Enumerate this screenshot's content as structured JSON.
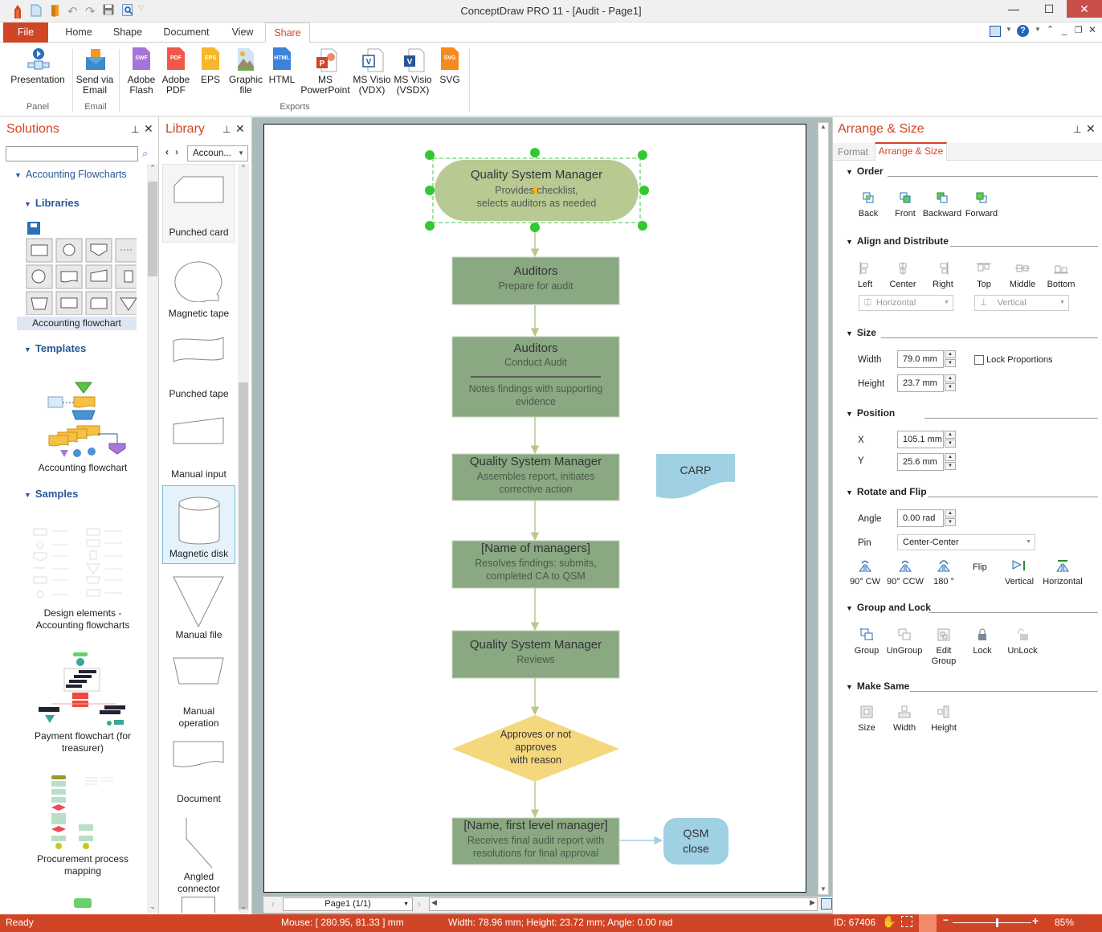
{
  "window": {
    "title": "ConceptDraw PRO 11 - [Audit - Page1]",
    "minimize": "—",
    "maximize": "☐",
    "close": "✕"
  },
  "ribbon_tabs": [
    {
      "label": "File"
    },
    {
      "label": "Home"
    },
    {
      "label": "Shape"
    },
    {
      "label": "Document"
    },
    {
      "label": "View"
    },
    {
      "label": "Share",
      "active": true
    }
  ],
  "ribbon": {
    "groups": [
      {
        "label": "Panel"
      },
      {
        "label": "Email"
      },
      {
        "label": "Exports"
      }
    ],
    "buttons": [
      {
        "label": "Presentation",
        "icon": "presentation-icon"
      },
      {
        "label": "Send via\nEmail",
        "icon": "email-icon"
      },
      {
        "label": "Adobe\nFlash",
        "icon": "swf-file-icon",
        "badge": "SWF",
        "color": "#a674d6"
      },
      {
        "label": "Adobe\nPDF",
        "icon": "pdf-file-icon",
        "badge": "PDF",
        "color": "#f0584a"
      },
      {
        "label": "EPS",
        "icon": "eps-file-icon",
        "badge": "EPS",
        "color": "#f8b62a"
      },
      {
        "label": "Graphic\nfile",
        "icon": "image-file-icon"
      },
      {
        "label": "HTML",
        "icon": "html-file-icon",
        "badge": "HTML",
        "color": "#3c82d8"
      },
      {
        "label": "MS\nPowerPoint",
        "icon": "powerpoint-icon"
      },
      {
        "label": "MS Visio\n(VDX)",
        "icon": "visio-vdx-icon"
      },
      {
        "label": "MS Visio\n(VSDX)",
        "icon": "visio-vsdx-icon"
      },
      {
        "label": "SVG",
        "icon": "svg-file-icon",
        "badge": "SVG",
        "color": "#f58a1f"
      }
    ]
  },
  "solutions": {
    "title": "Solutions",
    "search_value": "",
    "search_placeholder": "",
    "tree": {
      "root": "Accounting Flowcharts",
      "libraries": "Libraries",
      "templates": "Templates",
      "samples": "Samples"
    },
    "library_item": "Accounting flowchart",
    "template_item": "Accounting flowchart",
    "sample_items": [
      "Design elements -\nAccounting flowcharts",
      "Payment flowchart (for\ntreasurer)",
      "Procurement process\nmapping"
    ]
  },
  "library": {
    "title": "Library",
    "selected": "Accoun...",
    "items": [
      {
        "label": "Punched card"
      },
      {
        "label": "Magnetic tape"
      },
      {
        "label": "Punched tape"
      },
      {
        "label": "Manual input"
      },
      {
        "label": "Magnetic disk",
        "selected": true
      },
      {
        "label": "Manual file"
      },
      {
        "label": "Manual\noperation"
      },
      {
        "label": "Document"
      },
      {
        "label": "Angled\nconnector"
      }
    ]
  },
  "diagram": {
    "nodes": [
      {
        "id": "n1",
        "title": "Quality System Manager",
        "text": "Provides checklist,\nselects auditors as needed",
        "shape": "terminator",
        "selected": true
      },
      {
        "id": "n2",
        "title": "Auditors",
        "text": "Prepare for audit",
        "shape": "process"
      },
      {
        "id": "n3",
        "title": "Auditors",
        "text": "Conduct Audit",
        "note": "Notes findings with supporting\nevidence",
        "shape": "process"
      },
      {
        "id": "n4",
        "title": "Quality System Manager",
        "text": "Assembles report, initiates\ncorrective action",
        "shape": "process"
      },
      {
        "id": "n5",
        "title": "[Name of managers]",
        "text": "Resolves findings: submits,\ncompleted CA to QSM",
        "shape": "process"
      },
      {
        "id": "n6",
        "title": "Quality System Manager",
        "text": "Reviews",
        "shape": "process"
      },
      {
        "id": "n7",
        "title": "Approves or not\napproves\nwith reason",
        "shape": "decision"
      },
      {
        "id": "n8",
        "title": "[Name, first level manager]",
        "text": "Receives final audit report with\nresolutions for final approval",
        "shape": "process"
      },
      {
        "id": "n9",
        "title": "CARP",
        "shape": "document"
      },
      {
        "id": "n10",
        "title": "QSM\nclose",
        "shape": "terminal"
      }
    ],
    "colors": {
      "process": "#8aa882",
      "terminator": "#b8c992",
      "decision": "#f5d77e",
      "blue": "#9fd0e3",
      "connector": "#b7c98a"
    }
  },
  "page_nav": {
    "page": "Page1 (1/1)"
  },
  "arrange": {
    "title": "Arrange & Size",
    "tabs": [
      {
        "label": "Format"
      },
      {
        "label": "Arrange & Size",
        "active": true
      }
    ],
    "order": {
      "title": "Order",
      "buttons": [
        "Back",
        "Front",
        "Backward",
        "Forward"
      ]
    },
    "align": {
      "title": "Align and Distribute",
      "buttons": [
        "Left",
        "Center",
        "Right",
        "Top",
        "Middle",
        "Bottom"
      ],
      "horizontal": "Horizontal",
      "vertical": "Vertical"
    },
    "size": {
      "title": "Size",
      "width_label": "Width",
      "width": "79.0 mm",
      "height_label": "Height",
      "height": "23.7 mm",
      "lock": "Lock Proportions",
      "lock_checked": false
    },
    "position": {
      "title": "Position",
      "x_label": "X",
      "x": "105.1 mm",
      "y_label": "Y",
      "y": "25.6 mm"
    },
    "rotate": {
      "title": "Rotate and Flip",
      "angle_label": "Angle",
      "angle": "0.00 rad",
      "pin_label": "Pin",
      "pin": "Center-Center",
      "buttons": [
        "90° CW",
        "90° CCW",
        "180 °"
      ],
      "flip": "Flip",
      "flip_buttons": [
        "Vertical",
        "Horizontal"
      ]
    },
    "group": {
      "title": "Group and Lock",
      "buttons": [
        "Group",
        "UnGroup",
        "Edit\nGroup",
        "Lock",
        "UnLock"
      ]
    },
    "same": {
      "title": "Make Same",
      "buttons": [
        "Size",
        "Width",
        "Height"
      ]
    }
  },
  "status": {
    "ready": "Ready",
    "mouse": "Mouse: [ 280.95, 81.33 ] mm",
    "dims": "Width: 78.96 mm;  Height: 23.72 mm;  Angle: 0.00 rad",
    "id": "ID: 67406",
    "zoom": "85%",
    "zoom_fraction": 0.55
  }
}
